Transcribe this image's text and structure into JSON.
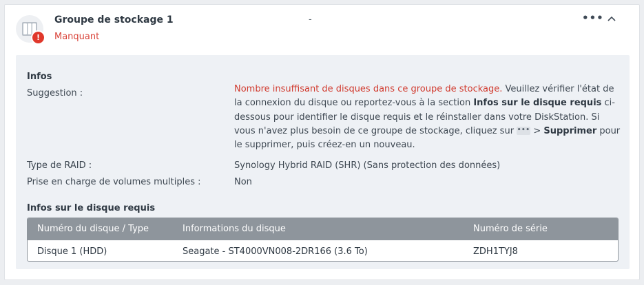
{
  "header": {
    "title": "Groupe de stockage 1",
    "status": "Manquant",
    "middle": "-",
    "more_label": "•••"
  },
  "info": {
    "section_title": "Infos",
    "suggestion_label": "Suggestion :",
    "suggestion": {
      "red": "Nombre insuffisant de disques dans ce groupe de stockage.",
      "part1": " Veuillez vérifier l'état de la connexion du disque ou reportez-vous à la section ",
      "bold1": "Infos sur le disque requis",
      "part2": " ci-dessous pour identifier le disque requis et le réinstaller dans votre DiskStation. Si vous n'avez plus besoin de ce groupe de stockage, cliquez sur ",
      "chip": "•••",
      "part3": " > ",
      "bold2": "Supprimer",
      "part4": " pour le supprimer, puis créez-en un nouveau."
    },
    "raid_label": "Type de RAID :",
    "raid_value": "Synology Hybrid RAID (SHR) (Sans protection des données)",
    "multi_label": "Prise en charge de volumes multiples :",
    "multi_value": "Non"
  },
  "required": {
    "section_title": "Infos sur le disque requis",
    "columns": [
      "Numéro du disque / Type",
      "Informations du disque",
      "Numéro de série"
    ],
    "rows": [
      [
        "Disque 1 (HDD)",
        "Seagate - ST4000VN008-2DR166 (3.6 To)",
        "ZDH1TYJ8"
      ]
    ]
  },
  "colors": {
    "alert": "#e0382b",
    "header_row": "#8e959c",
    "panel": "#eef1f5"
  }
}
